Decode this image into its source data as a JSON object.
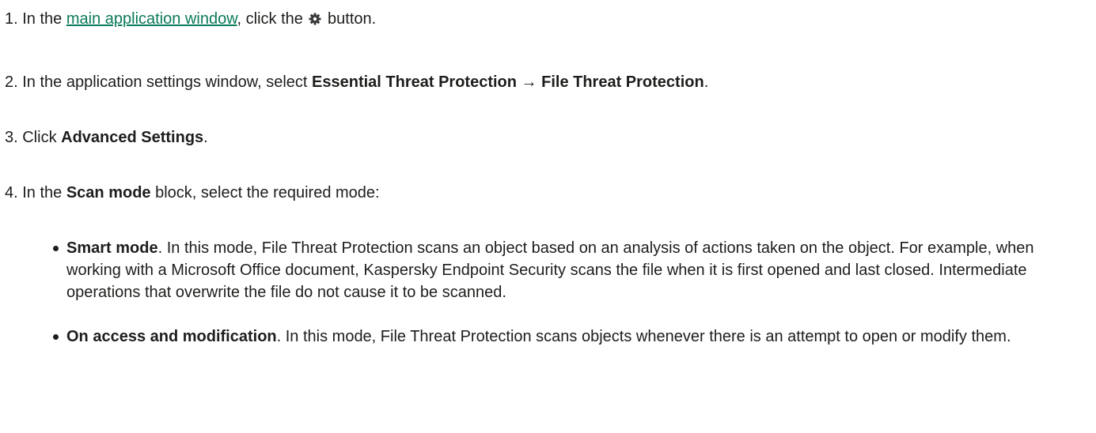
{
  "steps": {
    "s1": {
      "before": "1. In the ",
      "link": "main application window",
      "middle": ", click the ",
      "icon": "gear-icon",
      "after": " button."
    },
    "s2": {
      "before": "2. In the application settings window, select ",
      "bold1": "Essential Threat Protection",
      "arrow": " → ",
      "bold2": "File Threat Protection",
      "after": "."
    },
    "s3": {
      "before": "3. Click ",
      "bold": "Advanced Settings",
      "after": "."
    },
    "s4": {
      "before": "4. In the ",
      "bold": "Scan mode",
      "after": " block, select the required mode:"
    }
  },
  "modes": [
    {
      "title": "Smart mode",
      "text": ". In this mode, File Threat Protection scans an object based on an analysis of actions taken on the object. For example, when working with a Microsoft Office document, Kaspersky Endpoint Security scans the file when it is first opened and last closed. Intermediate operations that overwrite the file do not cause it to be scanned."
    },
    {
      "title": "On access and modification",
      "text": ". In this mode, File Threat Protection scans objects whenever there is an attempt to open or modify them."
    }
  ],
  "colors": {
    "link": "#0a7a5a",
    "text": "#1d1d1b"
  }
}
